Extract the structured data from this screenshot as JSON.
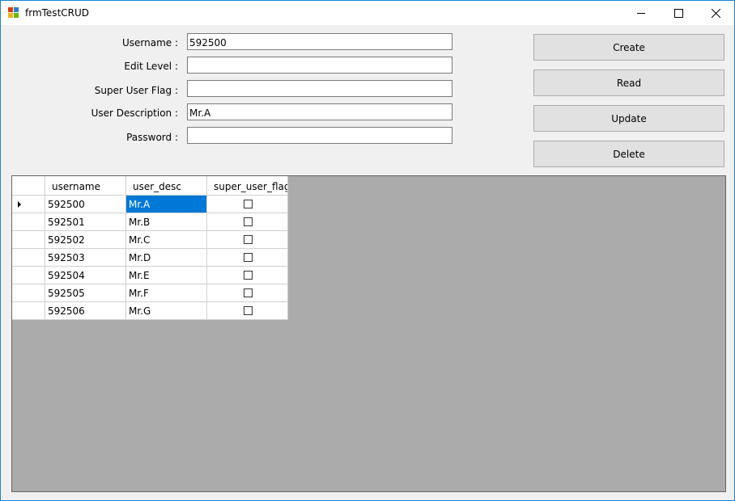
{
  "window": {
    "title": "frmTestCRUD",
    "accent_color": "#1883d7",
    "controls": {
      "minimize_icon": "minimize-icon",
      "maximize_icon": "maximize-icon",
      "close_icon": "close-icon"
    }
  },
  "form": {
    "username": {
      "label": "Username :",
      "value": "592500"
    },
    "edit_level": {
      "label": "Edit Level :",
      "value": ""
    },
    "super_user_flag": {
      "label": "Super User Flag :",
      "value": ""
    },
    "user_description": {
      "label": "User Description :",
      "value": "Mr.A"
    },
    "password": {
      "label": "Password :",
      "value": ""
    }
  },
  "buttons": {
    "create": "Create",
    "read": "Read",
    "update": "Update",
    "delete": "Delete"
  },
  "grid": {
    "columns": [
      "username",
      "user_desc",
      "super_user_flag"
    ],
    "rows": [
      {
        "username": "592500",
        "user_desc": "Mr.A",
        "super_user_flag": false
      },
      {
        "username": "592501",
        "user_desc": "Mr.B",
        "super_user_flag": false
      },
      {
        "username": "592502",
        "user_desc": "Mr.C",
        "super_user_flag": false
      },
      {
        "username": "592503",
        "user_desc": "Mr.D",
        "super_user_flag": false
      },
      {
        "username": "592504",
        "user_desc": "Mr.E",
        "super_user_flag": false
      },
      {
        "username": "592505",
        "user_desc": "Mr.F",
        "super_user_flag": false
      },
      {
        "username": "592506",
        "user_desc": "Mr.G",
        "super_user_flag": false
      }
    ],
    "current_row": 0,
    "selected_cell": {
      "row": 0,
      "column": "user_desc"
    },
    "selection_color": "#0078d7",
    "background_color": "#ababab"
  }
}
